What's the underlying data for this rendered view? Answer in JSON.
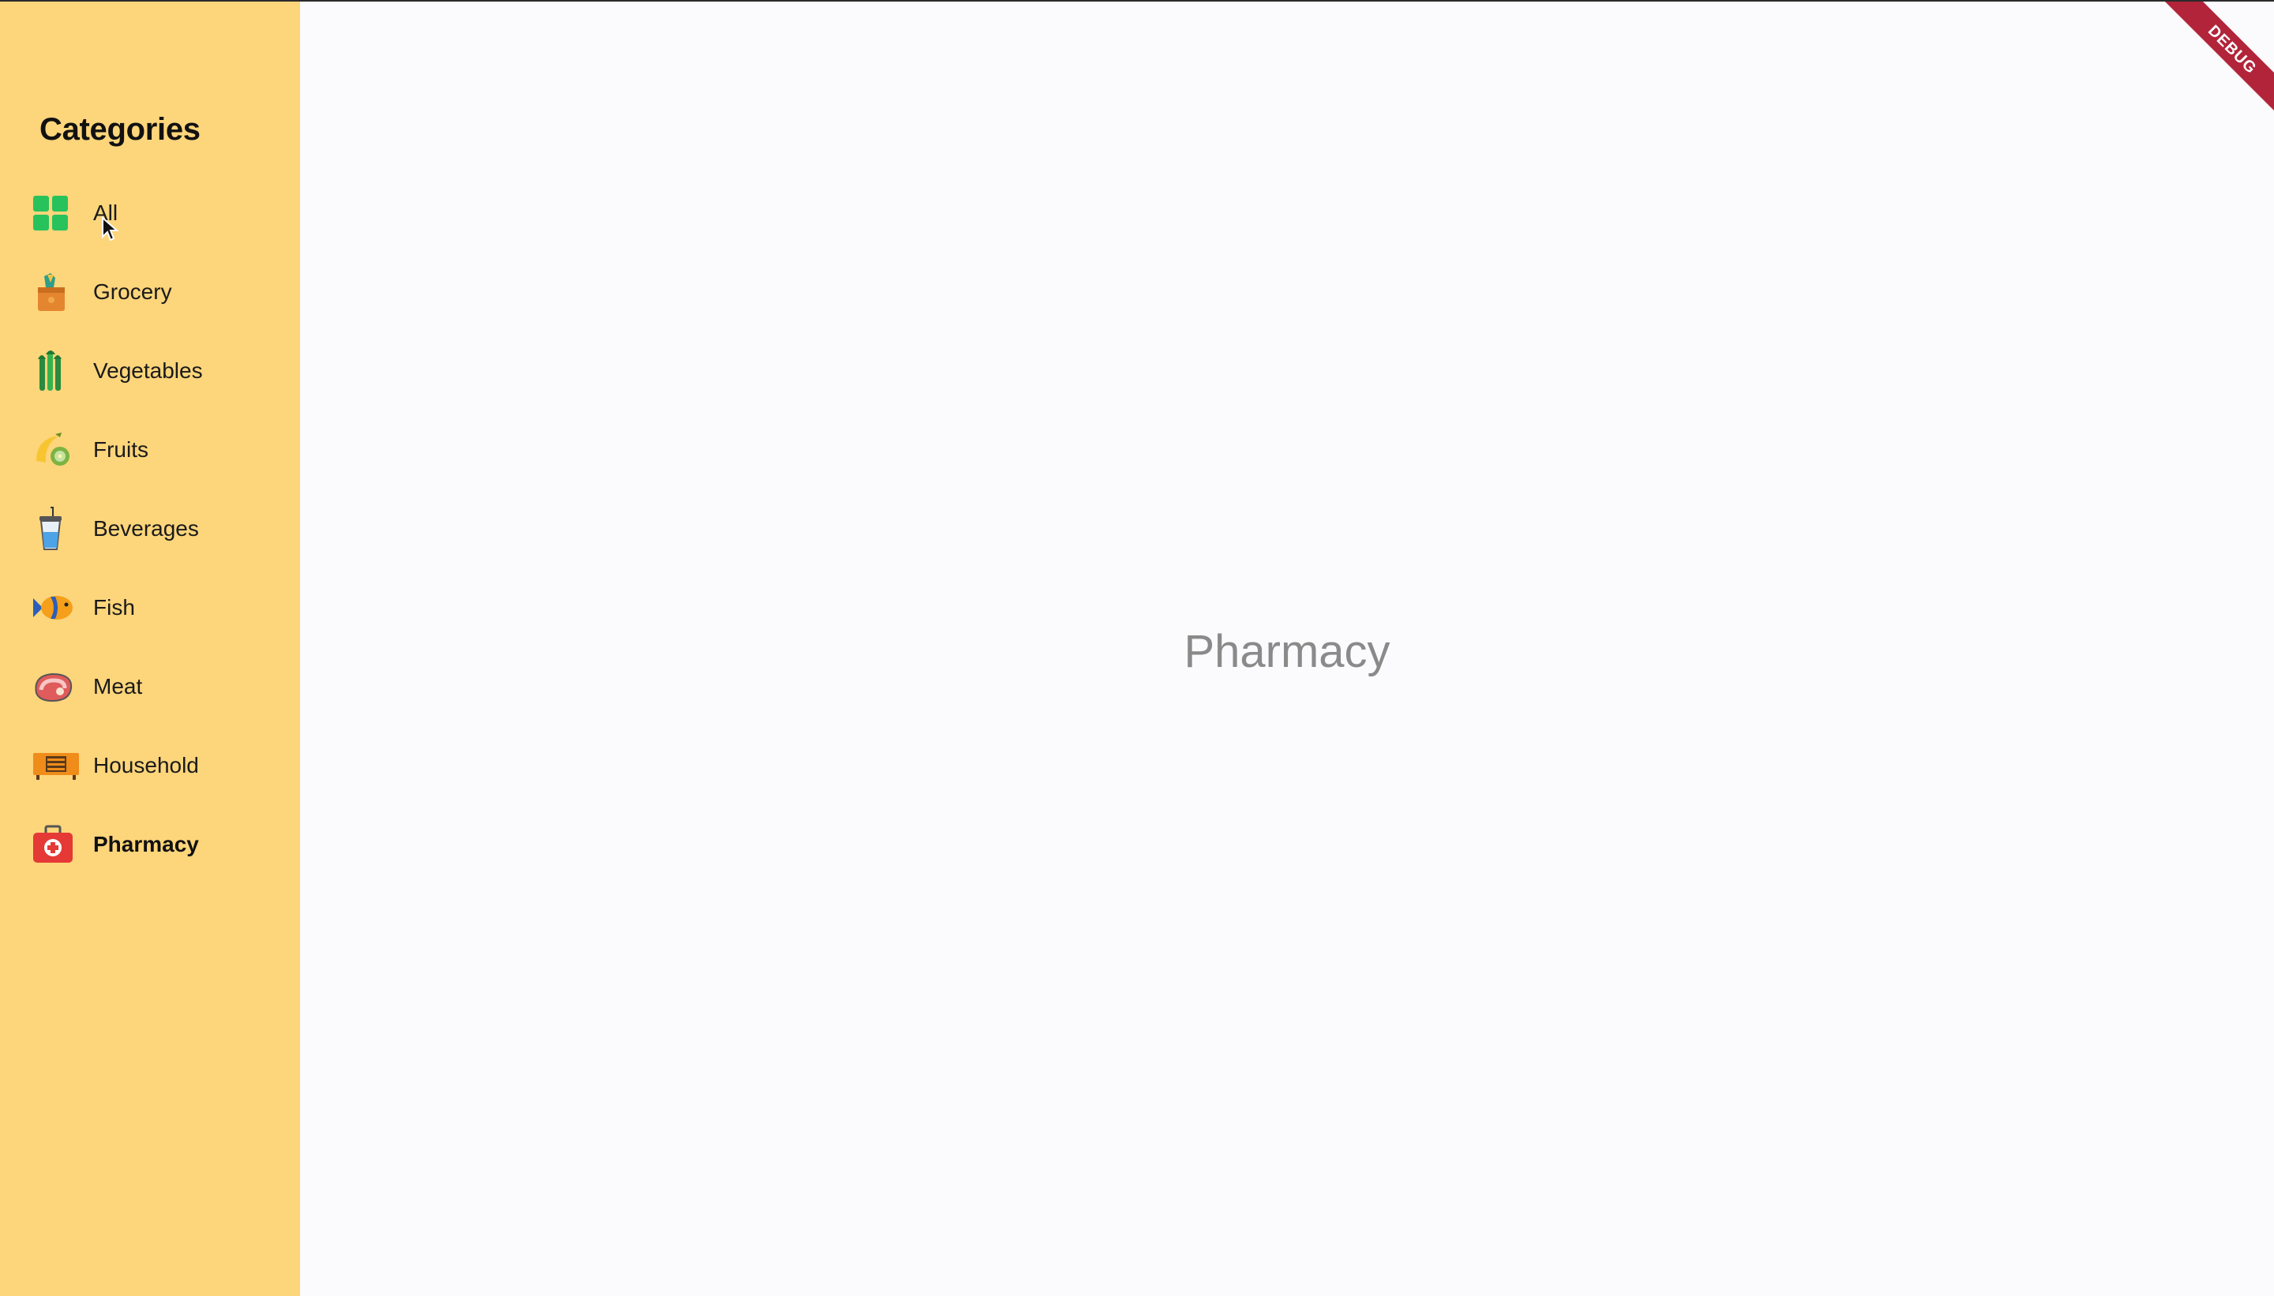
{
  "sidebar": {
    "title": "Categories",
    "items": [
      {
        "label": "All",
        "icon": "grid-icon",
        "active": false
      },
      {
        "label": "Grocery",
        "icon": "grocery-bag-icon",
        "active": false
      },
      {
        "label": "Vegetables",
        "icon": "vegetables-icon",
        "active": false
      },
      {
        "label": "Fruits",
        "icon": "fruits-icon",
        "active": false
      },
      {
        "label": "Beverages",
        "icon": "beverage-cup-icon",
        "active": false
      },
      {
        "label": "Fish",
        "icon": "fish-icon",
        "active": false
      },
      {
        "label": "Meat",
        "icon": "meat-icon",
        "active": false
      },
      {
        "label": "Household",
        "icon": "household-icon",
        "active": false
      },
      {
        "label": "Pharmacy",
        "icon": "first-aid-kit-icon",
        "active": true
      }
    ]
  },
  "main": {
    "title": "Pharmacy"
  },
  "debug_banner": "DEBUG",
  "colors": {
    "sidebar_bg": "#fdd57b",
    "main_bg": "#fbfbfd",
    "ribbon": "#b2243a",
    "title_text": "#8a8a8a"
  }
}
